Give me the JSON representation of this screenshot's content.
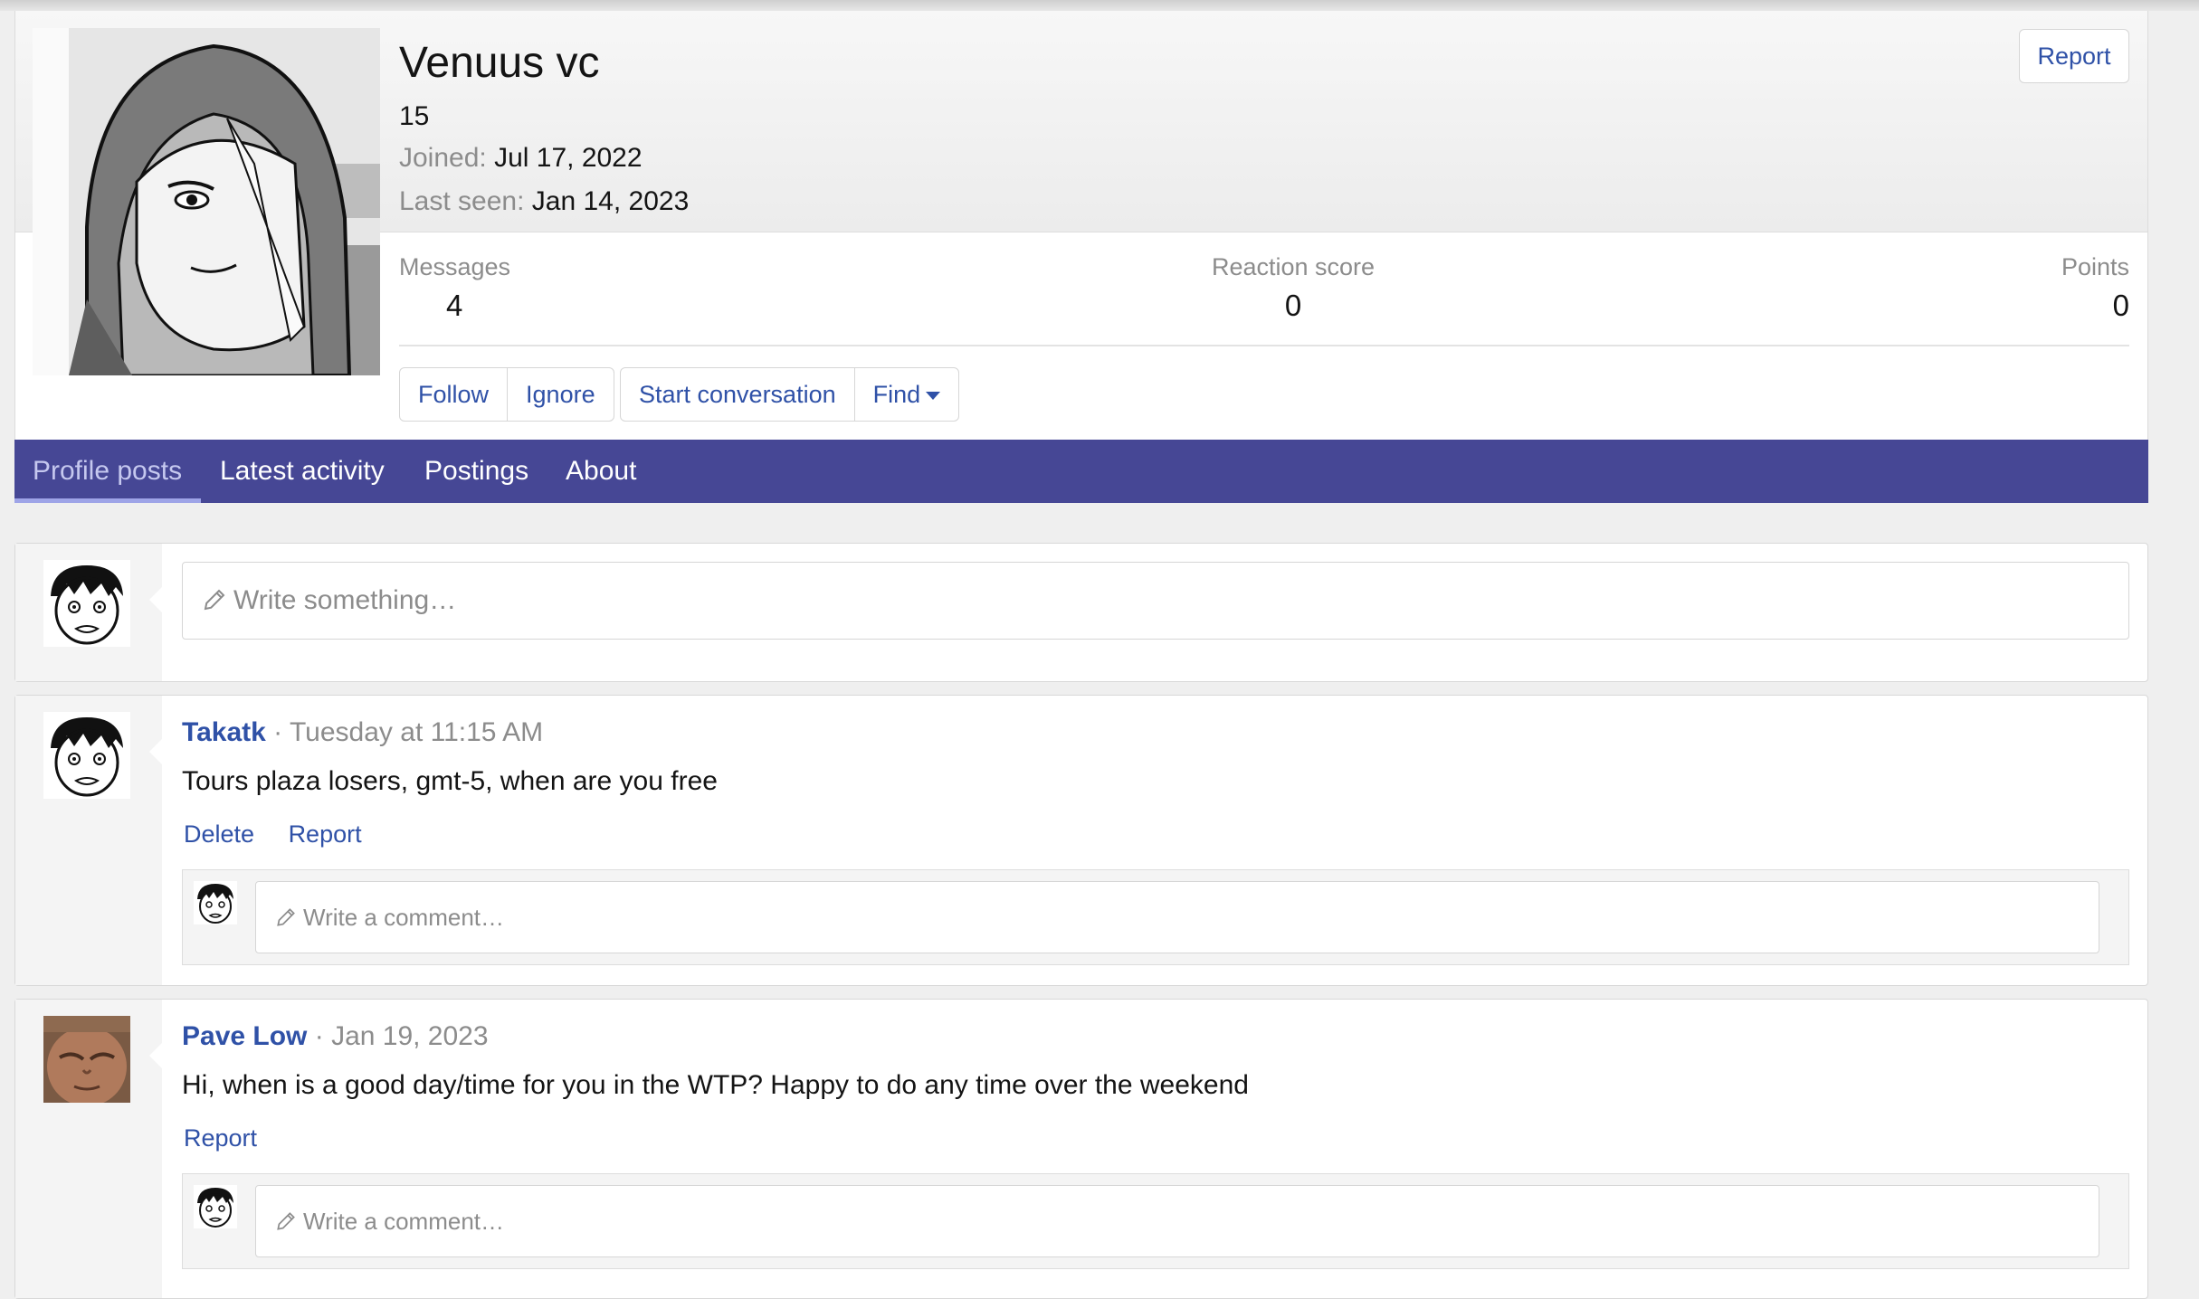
{
  "profile": {
    "name": "Venuus vc",
    "count": "15",
    "joined_label": "Joined:",
    "joined_value": "Jul 17, 2022",
    "last_seen_label": "Last seen:",
    "last_seen_value": "Jan 14, 2023",
    "report_label": "Report",
    "stats": {
      "messages_label": "Messages",
      "messages_value": "4",
      "reaction_label": "Reaction score",
      "reaction_value": "0",
      "points_label": "Points",
      "points_value": "0"
    },
    "buttons": {
      "follow": "Follow",
      "ignore": "Ignore",
      "start_conversation": "Start conversation",
      "find": "Find"
    }
  },
  "tabs": [
    {
      "label": "Profile posts",
      "active": true
    },
    {
      "label": "Latest activity",
      "active": false
    },
    {
      "label": "Postings",
      "active": false
    },
    {
      "label": "About",
      "active": false
    }
  ],
  "composer": {
    "placeholder": "Write something…"
  },
  "posts": [
    {
      "author": "Takatk",
      "time": "Tuesday at 11:15 AM",
      "body": "Tours plaza losers, gmt-5, when are you free",
      "actions": [
        "Delete",
        "Report"
      ],
      "comment_placeholder": "Write a comment…"
    },
    {
      "author": "Pave Low",
      "time": "Jan 19, 2023",
      "body": "Hi, when is a good day/time for you in the WTP? Happy to do any time over the weekend",
      "actions": [
        "Report"
      ],
      "comment_placeholder": "Write a comment…"
    }
  ],
  "colors": {
    "tab_bar": "#464795",
    "link": "#2f51a7",
    "muted": "#8c8c8c"
  }
}
